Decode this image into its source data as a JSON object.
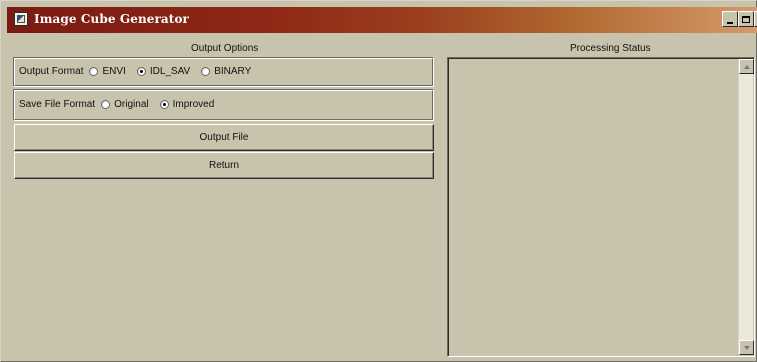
{
  "window": {
    "title": "Image Cube Generator"
  },
  "titlebar_controls": {
    "minimize_icon": "minimize-icon",
    "maximize_icon": "maximize-icon",
    "close_icon": "close-icon",
    "close_glyph": "×"
  },
  "left_panel": {
    "section_label": "Output Options",
    "output_format": {
      "label": "Output Format",
      "options": [
        {
          "label": "ENVI",
          "selected": false
        },
        {
          "label": "IDL_SAV",
          "selected": true
        },
        {
          "label": "BINARY",
          "selected": false
        }
      ]
    },
    "save_file_format": {
      "label": "Save File Format",
      "options": [
        {
          "label": "Original",
          "selected": false
        },
        {
          "label": "Improved",
          "selected": true
        }
      ]
    },
    "buttons": {
      "output_file": "Output File",
      "return": "Return"
    }
  },
  "right_panel": {
    "section_label": "Processing Status",
    "status_text": ""
  },
  "colors": {
    "window_background": "#c7c3ad",
    "titlebar_start": "#7a1a12",
    "titlebar_end": "#d79a6b"
  }
}
